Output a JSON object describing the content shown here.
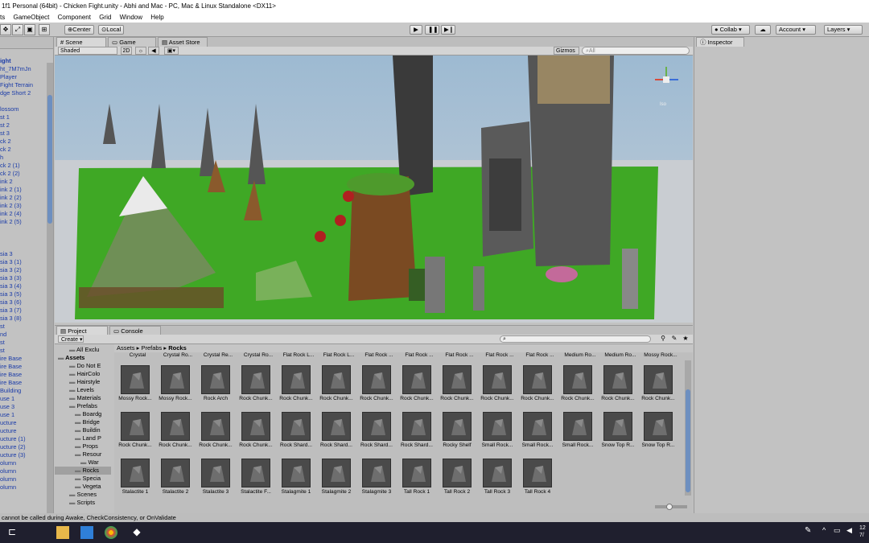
{
  "window": {
    "title": "1f1 Personal (64bit) - Chicken Fight.unity - Abhi and Mac - PC, Mac & Linux Standalone <DX11>"
  },
  "menu": {
    "items": [
      "ts",
      "GameObject",
      "Component",
      "Grid",
      "Window",
      "Help"
    ]
  },
  "toolbar": {
    "pivot_label": "Center",
    "space_label": "Local",
    "collab_label": "Collab",
    "account_label": "Account",
    "layers_label": "Layers"
  },
  "hierarchy": {
    "items": [
      "ight",
      "ht_7M7mJn",
      "Player",
      "Fight Terrain",
      "dge Short 2",
      "",
      "lossom",
      "st 1",
      "st 2",
      "st 3",
      "ck 2",
      "ck 2",
      "h",
      "ck 2 (1)",
      "ck 2 (2)",
      "ink 2",
      "ink 2 (1)",
      "ink 2 (2)",
      "ink 2 (3)",
      "ink 2 (4)",
      "ink 2 (5)",
      "",
      "",
      "",
      "sia 3",
      "sia 3 (1)",
      "sia 3 (2)",
      "sia 3 (3)",
      "sia 3 (4)",
      "sia 3 (5)",
      "sia 3 (6)",
      "sia 3 (7)",
      "sia 3 (8)",
      "st",
      "nd",
      "st",
      "st",
      "ire Base",
      "ire Base",
      "ire Base",
      "ire Base",
      "Building",
      "use 1",
      "use 3",
      "use 1",
      "ucture",
      "ucture",
      "ucture (1)",
      "ucture (2)",
      "ucture (3)",
      "olumn",
      "olumn",
      "olumn",
      "olumn"
    ]
  },
  "scene": {
    "tabs": [
      "Scene",
      "Game",
      "Asset Store"
    ],
    "shading": "Shaded",
    "mode2d": "2D",
    "gizmos": "Gizmos",
    "search_placeholder": "All",
    "persp_label": "Iso"
  },
  "inspector": {
    "tab": "Inspector"
  },
  "project": {
    "tabs": [
      "Project",
      "Console"
    ],
    "create_label": "Create",
    "breadcrumb": [
      "Assets",
      "Prefabs",
      "Rocks"
    ],
    "tree": [
      {
        "label": "All Exclu",
        "indent": 2
      },
      {
        "label": "Assets",
        "indent": 0,
        "bold": true
      },
      {
        "label": "Do Not E",
        "indent": 2
      },
      {
        "label": "HairColo",
        "indent": 2
      },
      {
        "label": "Hairstyle",
        "indent": 2
      },
      {
        "label": "Levels",
        "indent": 2
      },
      {
        "label": "Materials",
        "indent": 2
      },
      {
        "label": "Prefabs",
        "indent": 2
      },
      {
        "label": "Boardg",
        "indent": 3
      },
      {
        "label": "Bridge",
        "indent": 3
      },
      {
        "label": "Buildin",
        "indent": 3
      },
      {
        "label": "Land P",
        "indent": 3
      },
      {
        "label": "Props",
        "indent": 3
      },
      {
        "label": "Resour",
        "indent": 3
      },
      {
        "label": "War",
        "indent": 4
      },
      {
        "label": "Rocks",
        "indent": 3
      },
      {
        "label": "Specia",
        "indent": 3
      },
      {
        "label": "Vegeta",
        "indent": 3
      },
      {
        "label": "Scenes",
        "indent": 2
      },
      {
        "label": "Scripts",
        "indent": 2
      }
    ],
    "top_labels": [
      "Crystal",
      "Crystal Ro...",
      "Crystal Re...",
      "Crystal Ro...",
      "Flat Rock L...",
      "Flat Rock L...",
      "Flat Rock ...",
      "Flat Rock ...",
      "Flat Rock ...",
      "Flat Rock ...",
      "Flat Rock ...",
      "Medium Ro...",
      "Medium Ro...",
      "Mossy Rock..."
    ],
    "row1": [
      "Mossy Rock...",
      "Mossy Rock...",
      "Rock Arch",
      "Rock Chunk...",
      "Rock Chunk...",
      "Rock Chunk...",
      "Rock Chunk...",
      "Rock Chunk...",
      "Rock Chunk...",
      "Rock Chunk...",
      "Rock Chunk...",
      "Rock Chunk...",
      "Rock Chunk...",
      "Rock Chunk..."
    ],
    "row2": [
      "Rock Chunk...",
      "Rock Chunk...",
      "Rock Chunk...",
      "Rock Chunk...",
      "Rock Shard...",
      "Rock Shard...",
      "Rock Shard...",
      "Rock Shard...",
      "Rocky Shelf",
      "Small Rock...",
      "Small Rock...",
      "Small Rock...",
      "Snow Top R...",
      "Snow Top R..."
    ],
    "row3": [
      "Stalactite 1",
      "Stalactite 2",
      "Stalactite 3",
      "Stalactite F...",
      "Stalagmite 1",
      "Stalagmite 2",
      "Stalagmite 3",
      "Tall Rock 1",
      "Tall Rock 2",
      "Tall Rock 3",
      "Tall Rock 4"
    ]
  },
  "status": {
    "message": "cannot be called during Awake, CheckConsistency, or OnValidate"
  },
  "taskbar": {
    "time": "12",
    "date": "7/"
  },
  "colors": {
    "sky": "#a7c1d6",
    "grass": "#3fa825",
    "horizon": "#c9cdd2",
    "selection": "#3e6fc2",
    "link_text": "#1a3ba8"
  }
}
